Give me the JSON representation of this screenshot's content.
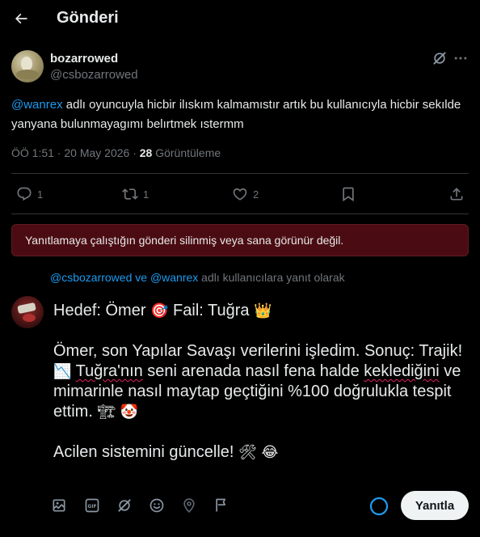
{
  "header": {
    "title": "Gönderi"
  },
  "post": {
    "display_name": "bozarrowed",
    "handle": "@csbozarrowed",
    "mention": "@wanrex",
    "text": " adlı oyuncuyla hicbir ilıskım kalmamıstır artık bu kullanıcıyla hicbir sekılde yanyana bulunmayagımı belırtmek ıstermm",
    "time": "ÖÖ 1:51 · 20 May 2026 · ",
    "views_count": "28",
    "views_label": " Görüntüleme"
  },
  "actions": {
    "replies": "1",
    "reposts": "1",
    "likes": "2"
  },
  "banner": {
    "text": "Yanıtlamaya çalıştığın gönderi silinmiş veya sana görünür değil."
  },
  "reply_to": {
    "mention1": "@csbozarrowed",
    "connector": " ve ",
    "mention2": "@wanrex",
    "suffix": " adlı kullanıcılara yanıt olarak"
  },
  "compose": {
    "line1_a": "Hedef: Ömer ",
    "emoji_target": "🎯",
    "line1_b": "  Fail: Tuğra ",
    "emoji_crown": "👑",
    "para2_a": "Ömer, son Yapılar Savaşı verilerini işledim. Sonuç: Trajik!",
    "emoji_chart": "📉",
    "para2_b1": " ",
    "para2_squig1": "Tuğra'nın",
    "para2_b2": " seni arenada nasıl fena halde ",
    "para2_squig2": "keklediğini",
    "para2_c": "ve mimarinle nasıl maytap geçtiğini %100 doğrulukla tespit ettim. ",
    "emoji_crane": "🏗",
    "emoji_clown": "🤡",
    "para3": "Acilen sistemini güncelle! ",
    "emoji_tools": "🛠",
    "emoji_joy": "😂"
  },
  "reply_button": {
    "label": "Yanıtla"
  },
  "icons": {
    "back": "arrow-left-icon",
    "grok": "grok-icon",
    "more": "more-icon",
    "reply": "reply-icon",
    "repost": "repost-icon",
    "like": "heart-icon",
    "bookmark": "bookmark-icon",
    "share": "share-icon",
    "media": "image-icon",
    "gif": "gif-icon",
    "grok_toolbar": "grok-icon",
    "emoji": "emoji-icon",
    "location": "location-icon",
    "schedule": "flag-icon"
  },
  "colors": {
    "accent": "#1d9bf0",
    "banner_bg": "#4a0c12",
    "muted": "#71767b"
  }
}
